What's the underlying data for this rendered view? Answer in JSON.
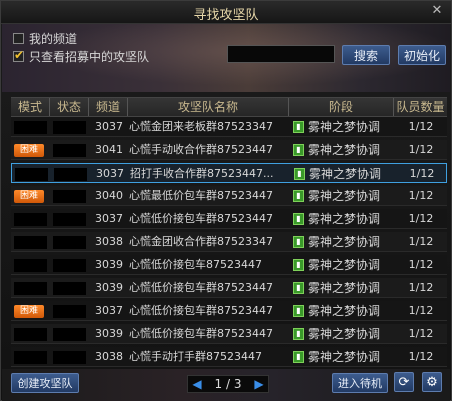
{
  "window": {
    "title": "寻找攻坚队",
    "close_glyph": "✕"
  },
  "filters": {
    "my_channel": {
      "label": "我的频道",
      "checked": false
    },
    "recruiting_only": {
      "label": "只查看招募中的攻坚队",
      "checked": true
    },
    "search_value": "",
    "search_button": "搜索",
    "reset_button": "初始化"
  },
  "table": {
    "headers": [
      "模式",
      "状态",
      "频道",
      "攻坚队名称",
      "阶段",
      "队员数量"
    ],
    "rows": [
      {
        "mode": "",
        "channel": "3037",
        "name": "心慌金团来老板群87523347",
        "stage": "雾神之梦协调",
        "members": "1/12"
      },
      {
        "mode": "困难",
        "channel": "3041",
        "name": "心慌手动收合作群87523447",
        "stage": "雾神之梦协调",
        "members": "1/12"
      },
      {
        "mode": "",
        "channel": "3037",
        "name": "招打手收合作群87523447...",
        "stage": "雾神之梦协调",
        "members": "1/12"
      },
      {
        "mode": "困难",
        "channel": "3040",
        "name": "心慌最低价包车群87523447",
        "stage": "雾神之梦协调",
        "members": "1/12"
      },
      {
        "mode": "",
        "channel": "3037",
        "name": "心慌低价接包车群87523447",
        "stage": "雾神之梦协调",
        "members": "1/12"
      },
      {
        "mode": "",
        "channel": "3038",
        "name": "心慌金团收合作群87523347",
        "stage": "雾神之梦协调",
        "members": "1/12"
      },
      {
        "mode": "",
        "channel": "3039",
        "name": "心慌低价接包车87523447",
        "stage": "雾神之梦协调",
        "members": "1/12"
      },
      {
        "mode": "",
        "channel": "3039",
        "name": "心慌低价接包车群87523447",
        "stage": "雾神之梦协调",
        "members": "1/12"
      },
      {
        "mode": "困难",
        "channel": "3037",
        "name": "心慌低价接包车群87523447",
        "stage": "雾神之梦协调",
        "members": "1/12"
      },
      {
        "mode": "",
        "channel": "3039",
        "name": "心慌低价接包车群87523447",
        "stage": "雾神之梦协调",
        "members": "1/12"
      },
      {
        "mode": "",
        "channel": "3038",
        "name": "心慌手动打手群87523447",
        "stage": "雾神之梦协调",
        "members": "1/12"
      }
    ],
    "selected_index": 2
  },
  "footer": {
    "create_button": "创建攻坚队",
    "page": "1 / 3",
    "join_button": "进入待机",
    "refresh_icon": "refresh-icon",
    "settings_icon": "gear-icon"
  },
  "colors": {
    "accent_blue": "#3d5c8e",
    "badge_orange": "#ff7a1a",
    "stage_green": "#3a9a2a",
    "selection_border": "#3fa0e0"
  }
}
